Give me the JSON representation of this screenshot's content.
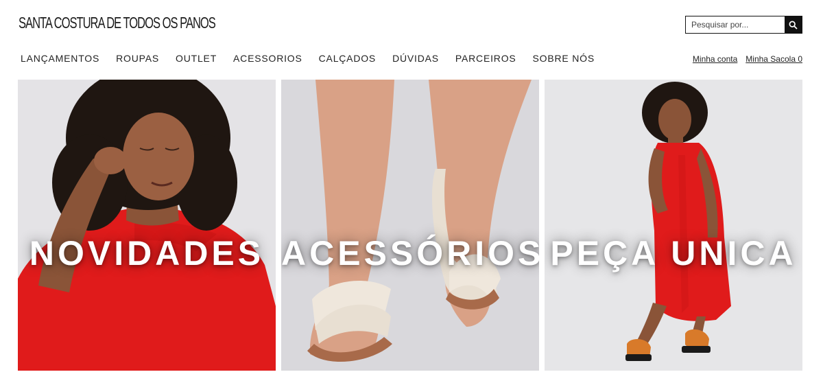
{
  "brand": {
    "logo_text": "SANTA COSTURA DE TODOS OS PANOS"
  },
  "search": {
    "placeholder": "Pesquisar por...",
    "icon": "search-icon"
  },
  "nav": {
    "items": [
      {
        "label": "LANÇAMENTOS"
      },
      {
        "label": "ROUPAS"
      },
      {
        "label": "OUTLET"
      },
      {
        "label": "ACESSORIOS"
      },
      {
        "label": "CALÇADOS"
      },
      {
        "label": "DÚVIDAS"
      },
      {
        "label": "PARCEIROS"
      },
      {
        "label": "SOBRE NÓS"
      }
    ]
  },
  "account": {
    "my_account": "Minha conta",
    "bag": "Minha Sacola 0"
  },
  "banners": [
    {
      "title": "NOVIDADES"
    },
    {
      "title": "ACESSÓRIOS"
    },
    {
      "title": "PEÇA UNICA"
    }
  ],
  "colors": {
    "accent_red": "#e01b1b",
    "text": "#222222",
    "banner_bg": "#e6e6e8"
  }
}
